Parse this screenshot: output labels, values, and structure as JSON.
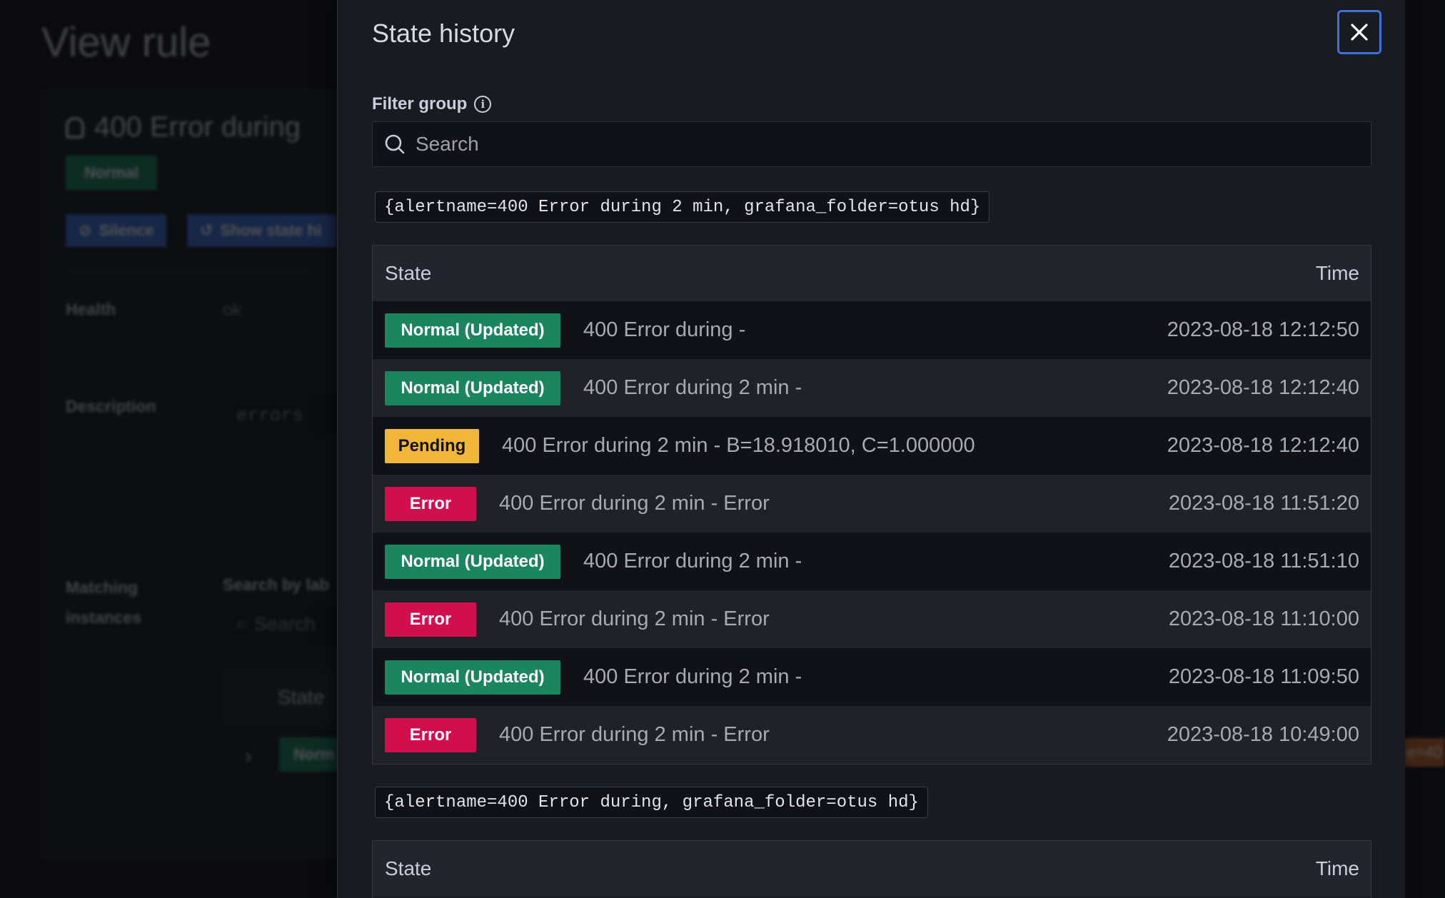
{
  "background": {
    "page_title": "View rule",
    "rule_title": "400 Error during",
    "state_badge": "Normal",
    "silence_button": "Silence",
    "show_state_history_button": "Show state hi",
    "health_label": "Health",
    "health_value": "ok",
    "description_label": "Description",
    "description_value": "errors",
    "matching_label_1": "Matching",
    "matching_label_2": "instances",
    "search_by_label": "Search by lab",
    "search_placeholder": "Search",
    "table_state_header": "State",
    "row_badge": "Norm",
    "orange_tag": "e=40"
  },
  "drawer": {
    "title": "State history",
    "filter_label": "Filter group",
    "search_placeholder": "Search",
    "groups": [
      {
        "label": "{alertname=400 Error during 2 min, grafana_folder=otus hd}",
        "state_header": "State",
        "time_header": "Time",
        "rows": [
          {
            "state": "Normal (Updated)",
            "kind": "normal",
            "text": "400 Error during -",
            "time": "2023-08-18 12:12:50"
          },
          {
            "state": "Normal (Updated)",
            "kind": "normal",
            "text": "400 Error during 2 min -",
            "time": "2023-08-18 12:12:40"
          },
          {
            "state": "Pending",
            "kind": "pending",
            "text": "400 Error during 2 min - B=18.918010, C=1.000000",
            "time": "2023-08-18 12:12:40"
          },
          {
            "state": "Error",
            "kind": "error",
            "text": "400 Error during 2 min - Error",
            "time": "2023-08-18 11:51:20"
          },
          {
            "state": "Normal (Updated)",
            "kind": "normal",
            "text": "400 Error during 2 min -",
            "time": "2023-08-18 11:51:10"
          },
          {
            "state": "Error",
            "kind": "error",
            "text": "400 Error during 2 min - Error",
            "time": "2023-08-18 11:10:00"
          },
          {
            "state": "Normal (Updated)",
            "kind": "normal",
            "text": "400 Error during 2 min -",
            "time": "2023-08-18 11:09:50"
          },
          {
            "state": "Error",
            "kind": "error",
            "text": "400 Error during 2 min - Error",
            "time": "2023-08-18 10:49:00"
          }
        ]
      },
      {
        "label": "{alertname=400 Error during, grafana_folder=otus hd}",
        "state_header": "State",
        "time_header": "Time",
        "rows": []
      }
    ]
  },
  "colors": {
    "normal": "#1b855e",
    "pending": "#f2b73a",
    "error": "#d20f4e",
    "accent": "#3d71d9"
  }
}
